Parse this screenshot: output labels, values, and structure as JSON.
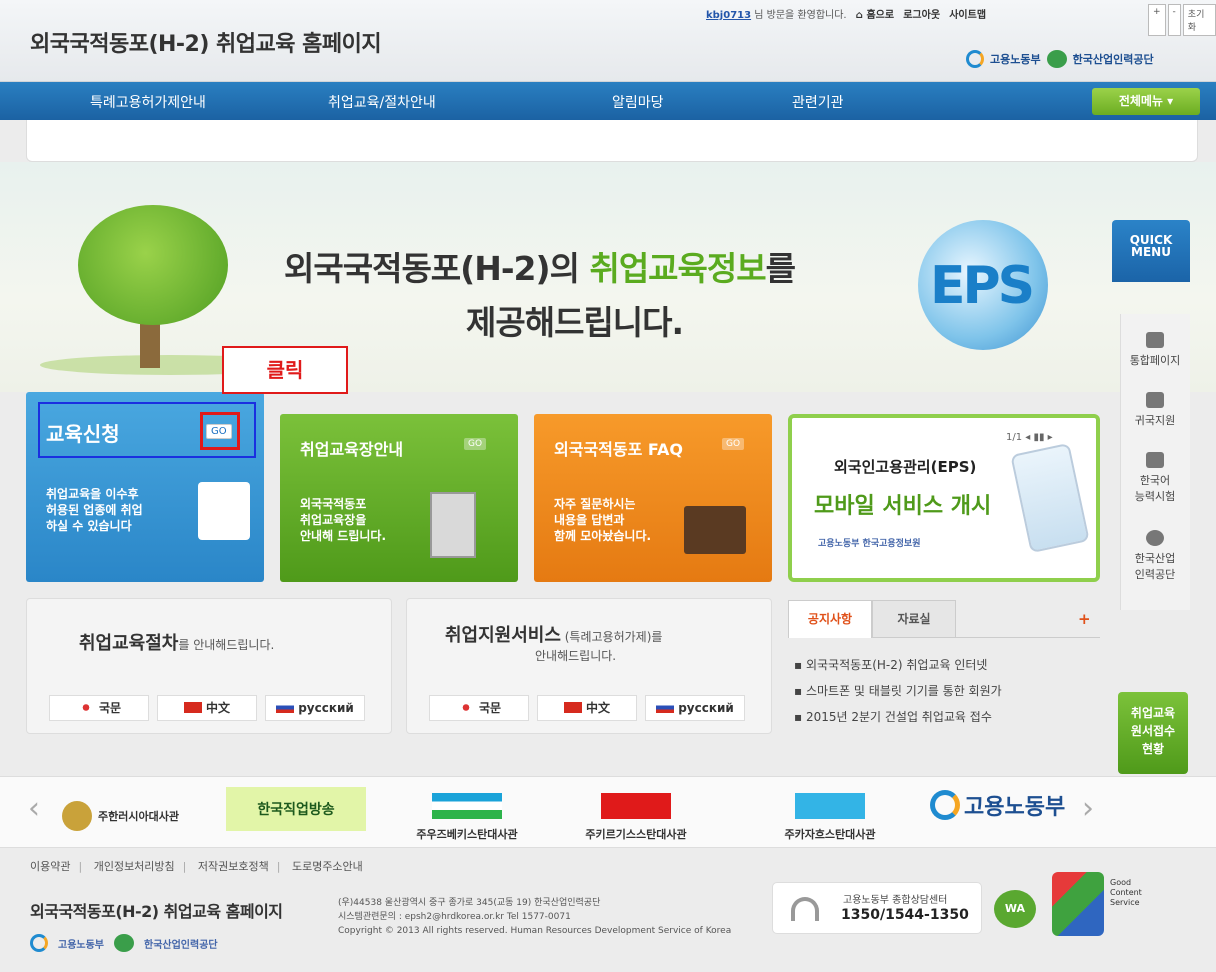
{
  "header": {
    "site_title": "외국국적동포(H-2) 취업교육 홈페이지",
    "user_id": "kbj0713",
    "welcome": "님 방문을 환영합니다.",
    "home": "홈으로",
    "logout": "로그아웃",
    "sitemap": "사이트맵",
    "font_plus": "+",
    "font_minus": "-",
    "font_reset": "초기화",
    "logo_ministry": "고용노동부",
    "logo_hrd": "한국산업인력공단"
  },
  "nav": {
    "items": [
      "특례고용허가제안내",
      "취업교육/절차안내",
      "알림마당",
      "관련기관"
    ],
    "all_menu": "전체메뉴 ▾"
  },
  "banner": {
    "line1_a": "외국국적동포(H-2)의 ",
    "line1_b": "취업교육정보",
    "line1_c": "를",
    "line2": "제공해드립니다.",
    "eps": "EPS"
  },
  "quick_menu": {
    "title": "QUICK MENU",
    "items": [
      "통합페이지",
      "귀국지원",
      "한국어\n능력시험",
      "한국산업\n인력공단"
    ],
    "apply_status": "취업교육\n원서접수\n현황"
  },
  "boxes": {
    "edu_title": "교육신청",
    "edu_desc": "취업교육을 이수후\n허용된 업종에 취업\n하실 수 있습니다",
    "center_title": "취업교육장안내",
    "center_desc": "외국국적동포\n취업교육장을\n안내해 드립니다.",
    "faq_title": "외국국적동포 FAQ",
    "faq_desc": "자주 질문하시는\n내용을 답변과\n함께 모아놨습니다.",
    "go": "GO",
    "mobile_pager": "1/1 ◂ ▮▮ ▸",
    "mobile_t1": "외국인고용관리(EPS)",
    "mobile_t2": "모바일 서비스 개시",
    "mobile_logos": "고용노동부   한국고용정보원"
  },
  "annotation": {
    "click": "클릭"
  },
  "procedure": {
    "p1_big": "취업교육절차",
    "p1_small": "를 안내해드립니다.",
    "p2_big": "취업지원서비스",
    "p2_small_a": " (특례고용허가제)를",
    "p2_small_b": "안내해드립니다.",
    "langs": [
      "국문",
      "中文",
      "русский"
    ]
  },
  "notice": {
    "tab1": "공지사항",
    "tab2": "자료실",
    "plus": "+",
    "items": [
      "외국국적동포(H-2) 취업교육 인터넷",
      "스마트폰 및 태블릿 기기를 통한 회원가",
      "2015년 2분기 건설업 취업교육 접수"
    ]
  },
  "links": {
    "russia": "주한러시아대사관",
    "tv": "한국직업방송",
    "uzbek": "주우즈베키스탄대사관",
    "kyrgyz": "주키르기스스탄대사관",
    "kazakh": "주카자흐스탄대사관",
    "ministry": "고용노동부",
    "prev": "‹",
    "next": "›"
  },
  "footer": {
    "links": [
      "이용약관",
      "개인정보처리방침",
      "저작권보호정책",
      "도로명주소안내"
    ],
    "site_name": "외국국적동포(H-2) 취업교육 홈페이지",
    "addr1": "(우)44538 울산광역시 중구 종가로 345(교동 19) 한국산업인력공단",
    "addr2": "시스템관련문의 : epsh2@hrdkorea.or.kr  Tel 1577-0071",
    "copyright": "Copyright © 2013 All rights reserved. Human Resources Development Service of Korea",
    "call_title": "고용노동부 종합상담센터",
    "call_number": "1350/1544-1350",
    "was": "WA",
    "gcs": "Good\nContent\nService",
    "logo_ministry": "고용노동부",
    "logo_hrd": "한국산업인력공단"
  }
}
